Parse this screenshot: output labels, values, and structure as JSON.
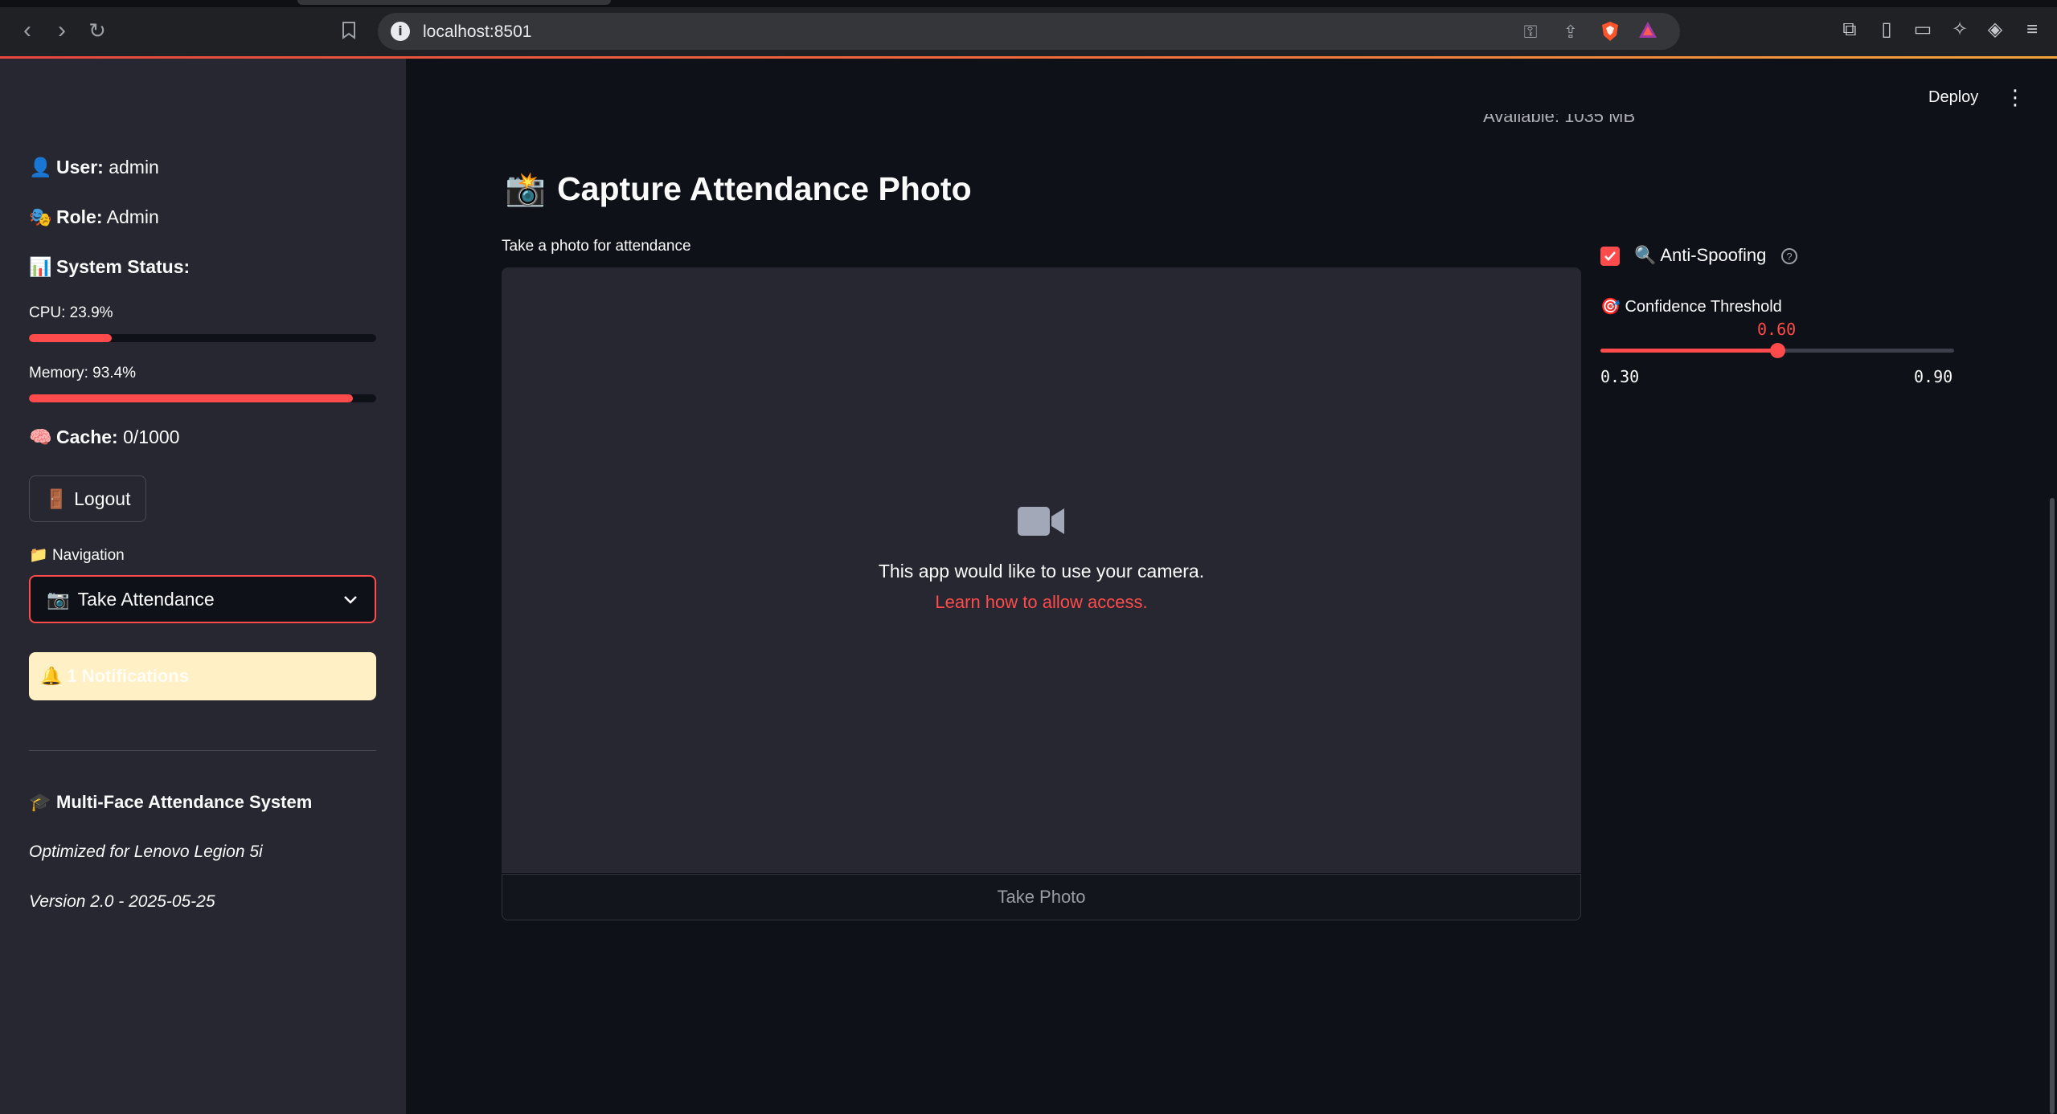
{
  "browser": {
    "url": "localhost:8501"
  },
  "sidebar": {
    "user_label": "User:",
    "user_value": "admin",
    "role_label": "Role:",
    "role_value": "Admin",
    "system_status_label": "System Status:",
    "cpu": {
      "label": "CPU: 23.9%",
      "percent": 23.9
    },
    "memory": {
      "label": "Memory: 93.4%",
      "percent": 93.4
    },
    "cache_label": "Cache:",
    "cache_value": "0/1000",
    "logout_label": "Logout",
    "navigation_label": "Navigation",
    "navigation_selected": "Take Attendance",
    "notifications_label": "1 Notifications",
    "app_name": "Multi-Face Attendance System",
    "optimized_text": "Optimized for Lenovo Legion 5i",
    "version_text": "Version 2.0 - 2025-05-25"
  },
  "header": {
    "deploy_label": "Deploy",
    "partial_text": "Available: 1035 MB"
  },
  "main": {
    "title": "Capture Attendance Photo",
    "camera_label": "Take a photo for attendance",
    "camera_message": "This app would like to use your camera.",
    "camera_link": "Learn how to allow access.",
    "take_photo_label": "Take Photo"
  },
  "controls": {
    "anti_spoofing_label": "Anti-Spoofing",
    "anti_spoofing_checked": true,
    "threshold_label": "Confidence Threshold",
    "threshold_value": "0.60",
    "threshold_min": "0.30",
    "threshold_max": "0.90",
    "threshold_numeric": 0.6,
    "threshold_range": [
      0.3,
      0.9
    ]
  },
  "colors": {
    "primary": "#ff4b4b",
    "background": "#0e1117",
    "sidebar": "#262730",
    "notification_bg": "#fff0c6"
  }
}
